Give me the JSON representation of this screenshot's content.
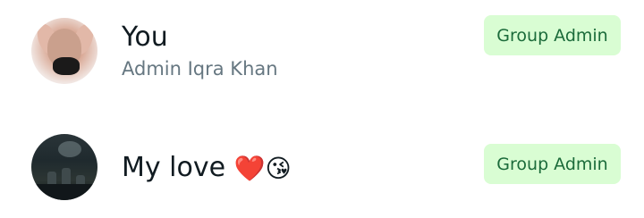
{
  "participants": [
    {
      "name": "You",
      "subtitle": "Admin Iqra Khan",
      "role_badge": "Group Admin",
      "avatar_icon": "profile-photo"
    },
    {
      "name": "My love",
      "name_emojis": "❤️😘",
      "role_badge": "Group Admin",
      "avatar_icon": "profile-photo"
    }
  ],
  "colors": {
    "badge_bg": "#d9fdd3",
    "badge_text": "#1b6b3a",
    "name_text": "#111b21",
    "subtitle_text": "#667781"
  }
}
